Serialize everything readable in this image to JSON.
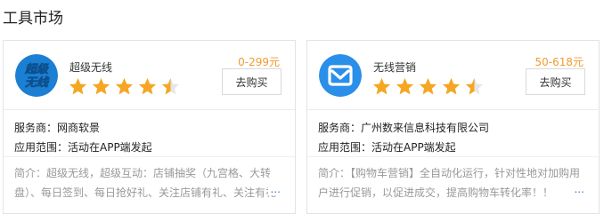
{
  "section": {
    "title": "工具市场"
  },
  "colors": {
    "price": "#f29a2f",
    "star": "#f5a623",
    "link": "#3b85d6",
    "logo1_bg": "#1b7fd4",
    "logo1_text": "#f5e31a",
    "logo2_bg": "#2a8fe8"
  },
  "cards": [
    {
      "logo_text_top": "超级",
      "logo_text_bottom": "无线",
      "name": "超级无线",
      "rating": 4.5,
      "price": "0-299元",
      "buy_label": "去购买",
      "provider": "服务商：网商软景",
      "scope": "应用范围：活动在APP端发起",
      "intro": "简介：超级无线，超级互动：店铺抽奖（九宫格、大转盘）、每日签到、每日抢好礼、关注店铺有礼、关注有礼",
      "more": "..."
    },
    {
      "logo_icon": "envelope-m-icon",
      "name": "无线营销",
      "rating": 4.5,
      "price": "50-618元",
      "buy_label": "去购买",
      "provider": "服务商：广州数来信息科技有限公司",
      "scope": "应用范围：活动在APP端发起",
      "intro": "简介：【购物车营销】全自动化运行，针对性地对加购用户进行促销，以促进成交，提高购物车转化率！！",
      "more": "..."
    }
  ]
}
